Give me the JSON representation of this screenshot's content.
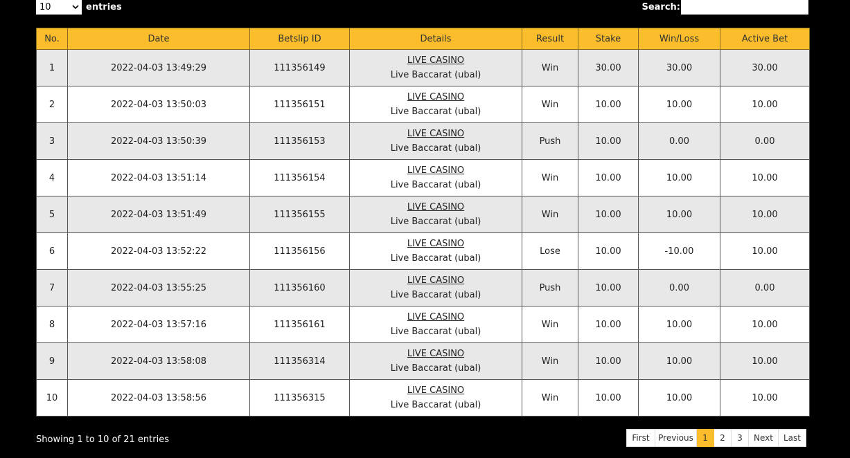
{
  "length_control": {
    "selected": "10",
    "label": "entries"
  },
  "search": {
    "label": "Search:",
    "value": ""
  },
  "table": {
    "headers": {
      "no": "No.",
      "date": "Date",
      "betslip": "Betslip ID",
      "details": "Details",
      "result": "Result",
      "stake": "Stake",
      "winloss": "Win/Loss",
      "active": "Active Bet"
    },
    "rows": [
      {
        "no": "1",
        "date": "2022-04-03 13:49:29",
        "betslip": "111356149",
        "category": "LIVE CASINO",
        "game": "Live Baccarat (ubal)",
        "result": "Win",
        "stake": "30.00",
        "winloss": "30.00",
        "active": "30.00"
      },
      {
        "no": "2",
        "date": "2022-04-03 13:50:03",
        "betslip": "111356151",
        "category": "LIVE CASINO",
        "game": "Live Baccarat (ubal)",
        "result": "Win",
        "stake": "10.00",
        "winloss": "10.00",
        "active": "10.00"
      },
      {
        "no": "3",
        "date": "2022-04-03 13:50:39",
        "betslip": "111356153",
        "category": "LIVE CASINO",
        "game": "Live Baccarat (ubal)",
        "result": "Push",
        "stake": "10.00",
        "winloss": "0.00",
        "active": "0.00"
      },
      {
        "no": "4",
        "date": "2022-04-03 13:51:14",
        "betslip": "111356154",
        "category": "LIVE CASINO",
        "game": "Live Baccarat (ubal)",
        "result": "Win",
        "stake": "10.00",
        "winloss": "10.00",
        "active": "10.00"
      },
      {
        "no": "5",
        "date": "2022-04-03 13:51:49",
        "betslip": "111356155",
        "category": "LIVE CASINO",
        "game": "Live Baccarat (ubal)",
        "result": "Win",
        "stake": "10.00",
        "winloss": "10.00",
        "active": "10.00"
      },
      {
        "no": "6",
        "date": "2022-04-03 13:52:22",
        "betslip": "111356156",
        "category": "LIVE CASINO",
        "game": "Live Baccarat (ubal)",
        "result": "Lose",
        "stake": "10.00",
        "winloss": "-10.00",
        "active": "10.00"
      },
      {
        "no": "7",
        "date": "2022-04-03 13:55:25",
        "betslip": "111356160",
        "category": "LIVE CASINO",
        "game": "Live Baccarat (ubal)",
        "result": "Push",
        "stake": "10.00",
        "winloss": "0.00",
        "active": "0.00"
      },
      {
        "no": "8",
        "date": "2022-04-03 13:57:16",
        "betslip": "111356161",
        "category": "LIVE CASINO",
        "game": "Live Baccarat (ubal)",
        "result": "Win",
        "stake": "10.00",
        "winloss": "10.00",
        "active": "10.00"
      },
      {
        "no": "9",
        "date": "2022-04-03 13:58:08",
        "betslip": "111356314",
        "category": "LIVE CASINO",
        "game": "Live Baccarat (ubal)",
        "result": "Win",
        "stake": "10.00",
        "winloss": "10.00",
        "active": "10.00"
      },
      {
        "no": "10",
        "date": "2022-04-03 13:58:56",
        "betslip": "111356315",
        "category": "LIVE CASINO",
        "game": "Live Baccarat (ubal)",
        "result": "Win",
        "stake": "10.00",
        "winloss": "10.00",
        "active": "10.00"
      }
    ]
  },
  "footer": {
    "info": "Showing 1 to 10 of 21 entries"
  },
  "pagination": {
    "first": "First",
    "previous": "Previous",
    "pages": [
      "1",
      "2",
      "3"
    ],
    "next": "Next",
    "last": "Last",
    "current": "1"
  },
  "colors": {
    "header_bg": "#fbbd2b",
    "odd_row": "#e8e8e8",
    "even_row": "#ffffff",
    "negative": "#e8271b",
    "page_bg": "#000000"
  }
}
